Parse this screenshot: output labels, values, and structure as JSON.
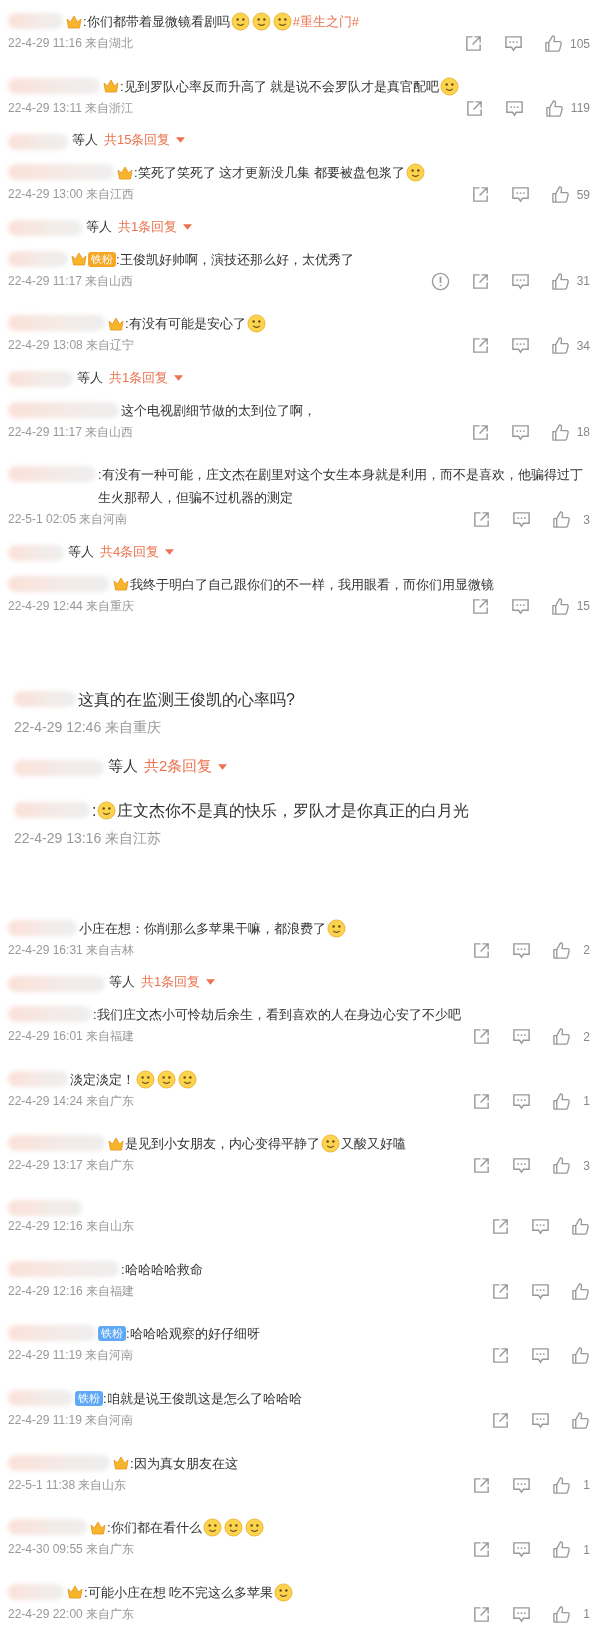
{
  "sections": [
    {
      "large": false,
      "items": [
        {
          "kind": "comment",
          "parts": [
            {
              "kind": "crown"
            },
            {
              "kind": "text",
              "text": ":你们都带着显微镜看剧吗"
            },
            {
              "kind": "emoji"
            },
            {
              "kind": "emoji"
            },
            {
              "kind": "emoji"
            },
            {
              "kind": "hashtag",
              "text": "#重生之门#"
            }
          ],
          "meta": "22-4-29 11:16 来自湖北",
          "actions": {
            "report": false,
            "likes": "105"
          }
        },
        {
          "kind": "comment",
          "parts": [
            {
              "kind": "crown"
            },
            {
              "kind": "text",
              "text": ":见到罗队心率反而升高了 就是说不会罗队才是真官配吧"
            },
            {
              "kind": "emoji"
            }
          ],
          "meta": "22-4-29 13:11 来自浙江",
          "actions": {
            "report": false,
            "likes": "119"
          }
        },
        {
          "kind": "replies",
          "suffix": "等人",
          "count": "共15条回复"
        },
        {
          "kind": "comment",
          "parts": [
            {
              "kind": "crown"
            },
            {
              "kind": "text",
              "text": ":笑死了笑死了 这才更新没几集 都要被盘包浆了"
            },
            {
              "kind": "emoji"
            }
          ],
          "meta": "22-4-29 13:00 来自江西",
          "actions": {
            "report": false,
            "likes": "59"
          }
        },
        {
          "kind": "replies",
          "suffix": "等人",
          "count": "共1条回复"
        },
        {
          "kind": "comment",
          "parts": [
            {
              "kind": "crown"
            },
            {
              "kind": "badge",
              "text": "铁粉",
              "color": "#f5a623"
            },
            {
              "kind": "text",
              "text": ":王俊凯好帅啊，演技还那么好，太优秀了"
            }
          ],
          "meta": "22-4-29 11:17 来自山西",
          "actions": {
            "report": true,
            "likes": "31"
          }
        },
        {
          "kind": "comment",
          "parts": [
            {
              "kind": "crown"
            },
            {
              "kind": "text",
              "text": ":有没有可能是安心了"
            },
            {
              "kind": "emoji"
            }
          ],
          "meta": "22-4-29 13:08 来自辽宁",
          "actions": {
            "report": false,
            "likes": "34"
          }
        },
        {
          "kind": "replies",
          "suffix": "等人",
          "count": "共1条回复"
        },
        {
          "kind": "comment",
          "parts": [
            {
              "kind": "text",
              "text": "这个电视剧细节做的太到位了啊，"
            }
          ],
          "meta": "22-4-29 11:17 来自山西",
          "actions": {
            "report": false,
            "likes": "18"
          }
        },
        {
          "kind": "comment",
          "parts": [
            {
              "kind": "text",
              "text": ":有没有一种可能，庄文杰在剧里对这个女生本身就是利用，而不是喜欢，他骗得过丁生火那帮人，但骗不过机器的测定"
            }
          ],
          "meta": "22-5-1 02:05 来自河南",
          "actions": {
            "report": false,
            "likes": "3"
          }
        },
        {
          "kind": "replies",
          "suffix": "等人",
          "count": "共4条回复"
        },
        {
          "kind": "comment",
          "parts": [
            {
              "kind": "crown"
            },
            {
              "kind": "text",
              "text": "我终于明白了自己跟你们的不一样，我用眼看，而你们用显微镜"
            }
          ],
          "meta": "22-4-29 12:44 来自重庆",
          "actions": {
            "report": false,
            "likes": "15"
          }
        }
      ]
    },
    {
      "large": true,
      "items": [
        {
          "kind": "comment",
          "parts": [
            {
              "kind": "text",
              "text": "这真的在监测王俊凯的心率吗?"
            }
          ],
          "meta": "22-4-29 12:46 来自重庆"
        },
        {
          "kind": "replies",
          "suffix": "等人",
          "count": "共2条回复"
        },
        {
          "kind": "comment",
          "parts": [
            {
              "kind": "text",
              "text": ":"
            },
            {
              "kind": "emoji"
            },
            {
              "kind": "text",
              "text": "庄文杰你不是真的快乐，罗队才是你真正的白月光"
            }
          ],
          "meta": "22-4-29 13:16 来自江苏"
        }
      ]
    },
    {
      "large": false,
      "items": [
        {
          "kind": "comment",
          "parts": [
            {
              "kind": "text",
              "text": "小庄在想：你削那么多苹果干嘛，都浪费了"
            },
            {
              "kind": "emoji"
            }
          ],
          "meta": "22-4-29 16:31 来自吉林",
          "actions": {
            "report": false,
            "likes": "2"
          }
        },
        {
          "kind": "replies",
          "suffix": "等人",
          "count": "共1条回复"
        },
        {
          "kind": "comment",
          "parts": [
            {
              "kind": "text",
              "text": ":我们庄文杰小可怜劫后余生，看到喜欢的人在身边心安了不少吧"
            }
          ],
          "meta": "22-4-29 16:01 来自福建",
          "actions": {
            "report": false,
            "likes": "2"
          }
        },
        {
          "kind": "comment",
          "parts": [
            {
              "kind": "text",
              "text": "淡定淡定！"
            },
            {
              "kind": "emoji"
            },
            {
              "kind": "emoji"
            },
            {
              "kind": "emoji"
            }
          ],
          "meta": "22-4-29 14:24 来自广东",
          "actions": {
            "report": false,
            "likes": "1"
          }
        },
        {
          "kind": "comment",
          "parts": [
            {
              "kind": "crown"
            },
            {
              "kind": "text",
              "text": "是见到小女朋友，内心变得平静了"
            },
            {
              "kind": "emoji"
            },
            {
              "kind": "text",
              "text": "又酸又好嗑"
            }
          ],
          "meta": "22-4-29 13:17 来自广东",
          "actions": {
            "report": false,
            "likes": "3"
          }
        },
        {
          "kind": "comment",
          "meta": "22-4-29 12:16 来自山东",
          "actions": {
            "report": false
          }
        },
        {
          "kind": "comment",
          "parts": [
            {
              "kind": "text",
              "text": ":哈哈哈哈救命"
            }
          ],
          "meta": "22-4-29 12:16 来自福建",
          "actions": {
            "report": false
          }
        },
        {
          "kind": "comment",
          "parts": [
            {
              "kind": "badge",
              "text": "铁粉",
              "color": "#5fa8f5"
            },
            {
              "kind": "text",
              "text": ":哈哈哈观察的好仔细呀"
            }
          ],
          "meta": "22-4-29 11:19 来自河南",
          "actions": {
            "report": false
          }
        },
        {
          "kind": "comment",
          "parts": [
            {
              "kind": "badge",
              "text": "铁粉",
              "color": "#5fa8f5"
            },
            {
              "kind": "text",
              "text": ":咱就是说王俊凯这是怎么了哈哈哈"
            }
          ],
          "meta": "22-4-29 11:19 来自河南",
          "actions": {
            "report": false
          }
        },
        {
          "kind": "comment",
          "parts": [
            {
              "kind": "crown"
            },
            {
              "kind": "text",
              "text": ":因为真女朋友在这"
            }
          ],
          "meta": "22-5-1 11:38 来自山东",
          "actions": {
            "report": false,
            "likes": "1"
          }
        },
        {
          "kind": "comment",
          "parts": [
            {
              "kind": "crown"
            },
            {
              "kind": "text",
              "text": ":你们都在看什么"
            },
            {
              "kind": "emoji"
            },
            {
              "kind": "emoji"
            },
            {
              "kind": "emoji"
            }
          ],
          "meta": "22-4-30 09:55 来自广东",
          "actions": {
            "report": false,
            "likes": "1"
          }
        },
        {
          "kind": "comment",
          "parts": [
            {
              "kind": "crown"
            },
            {
              "kind": "text",
              "text": ":可能小庄在想 吃不完这么多苹果"
            },
            {
              "kind": "emoji"
            }
          ],
          "meta": "22-4-29 22:00 来自广东",
          "actions": {
            "report": false,
            "likes": "1"
          }
        }
      ]
    }
  ]
}
